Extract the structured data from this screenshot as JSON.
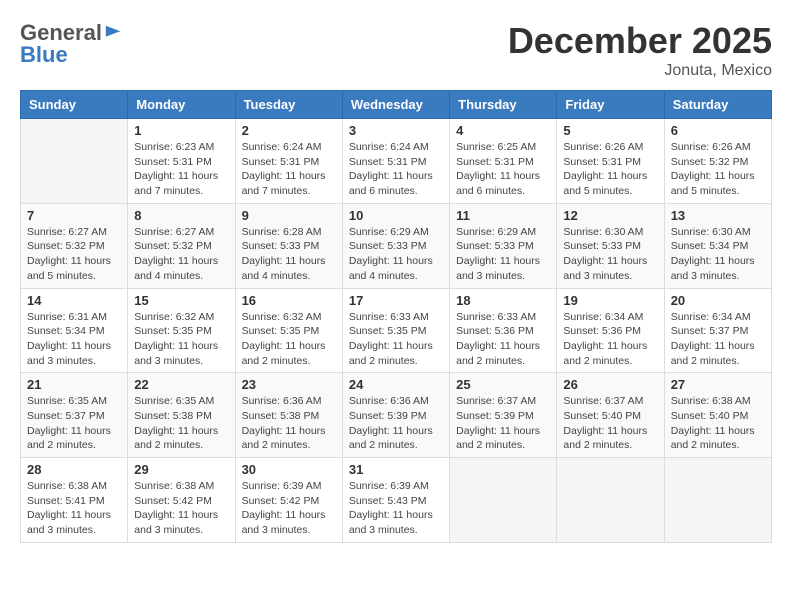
{
  "logo": {
    "general": "General",
    "blue": "Blue"
  },
  "title": {
    "month": "December 2025",
    "location": "Jonuta, Mexico"
  },
  "weekdays": [
    "Sunday",
    "Monday",
    "Tuesday",
    "Wednesday",
    "Thursday",
    "Friday",
    "Saturday"
  ],
  "weeks": [
    [
      {
        "day": "",
        "info": ""
      },
      {
        "day": "1",
        "info": "Sunrise: 6:23 AM\nSunset: 5:31 PM\nDaylight: 11 hours\nand 7 minutes."
      },
      {
        "day": "2",
        "info": "Sunrise: 6:24 AM\nSunset: 5:31 PM\nDaylight: 11 hours\nand 7 minutes."
      },
      {
        "day": "3",
        "info": "Sunrise: 6:24 AM\nSunset: 5:31 PM\nDaylight: 11 hours\nand 6 minutes."
      },
      {
        "day": "4",
        "info": "Sunrise: 6:25 AM\nSunset: 5:31 PM\nDaylight: 11 hours\nand 6 minutes."
      },
      {
        "day": "5",
        "info": "Sunrise: 6:26 AM\nSunset: 5:31 PM\nDaylight: 11 hours\nand 5 minutes."
      },
      {
        "day": "6",
        "info": "Sunrise: 6:26 AM\nSunset: 5:32 PM\nDaylight: 11 hours\nand 5 minutes."
      }
    ],
    [
      {
        "day": "7",
        "info": "Sunrise: 6:27 AM\nSunset: 5:32 PM\nDaylight: 11 hours\nand 5 minutes."
      },
      {
        "day": "8",
        "info": "Sunrise: 6:27 AM\nSunset: 5:32 PM\nDaylight: 11 hours\nand 4 minutes."
      },
      {
        "day": "9",
        "info": "Sunrise: 6:28 AM\nSunset: 5:33 PM\nDaylight: 11 hours\nand 4 minutes."
      },
      {
        "day": "10",
        "info": "Sunrise: 6:29 AM\nSunset: 5:33 PM\nDaylight: 11 hours\nand 4 minutes."
      },
      {
        "day": "11",
        "info": "Sunrise: 6:29 AM\nSunset: 5:33 PM\nDaylight: 11 hours\nand 3 minutes."
      },
      {
        "day": "12",
        "info": "Sunrise: 6:30 AM\nSunset: 5:33 PM\nDaylight: 11 hours\nand 3 minutes."
      },
      {
        "day": "13",
        "info": "Sunrise: 6:30 AM\nSunset: 5:34 PM\nDaylight: 11 hours\nand 3 minutes."
      }
    ],
    [
      {
        "day": "14",
        "info": "Sunrise: 6:31 AM\nSunset: 5:34 PM\nDaylight: 11 hours\nand 3 minutes."
      },
      {
        "day": "15",
        "info": "Sunrise: 6:32 AM\nSunset: 5:35 PM\nDaylight: 11 hours\nand 3 minutes."
      },
      {
        "day": "16",
        "info": "Sunrise: 6:32 AM\nSunset: 5:35 PM\nDaylight: 11 hours\nand 2 minutes."
      },
      {
        "day": "17",
        "info": "Sunrise: 6:33 AM\nSunset: 5:35 PM\nDaylight: 11 hours\nand 2 minutes."
      },
      {
        "day": "18",
        "info": "Sunrise: 6:33 AM\nSunset: 5:36 PM\nDaylight: 11 hours\nand 2 minutes."
      },
      {
        "day": "19",
        "info": "Sunrise: 6:34 AM\nSunset: 5:36 PM\nDaylight: 11 hours\nand 2 minutes."
      },
      {
        "day": "20",
        "info": "Sunrise: 6:34 AM\nSunset: 5:37 PM\nDaylight: 11 hours\nand 2 minutes."
      }
    ],
    [
      {
        "day": "21",
        "info": "Sunrise: 6:35 AM\nSunset: 5:37 PM\nDaylight: 11 hours\nand 2 minutes."
      },
      {
        "day": "22",
        "info": "Sunrise: 6:35 AM\nSunset: 5:38 PM\nDaylight: 11 hours\nand 2 minutes."
      },
      {
        "day": "23",
        "info": "Sunrise: 6:36 AM\nSunset: 5:38 PM\nDaylight: 11 hours\nand 2 minutes."
      },
      {
        "day": "24",
        "info": "Sunrise: 6:36 AM\nSunset: 5:39 PM\nDaylight: 11 hours\nand 2 minutes."
      },
      {
        "day": "25",
        "info": "Sunrise: 6:37 AM\nSunset: 5:39 PM\nDaylight: 11 hours\nand 2 minutes."
      },
      {
        "day": "26",
        "info": "Sunrise: 6:37 AM\nSunset: 5:40 PM\nDaylight: 11 hours\nand 2 minutes."
      },
      {
        "day": "27",
        "info": "Sunrise: 6:38 AM\nSunset: 5:40 PM\nDaylight: 11 hours\nand 2 minutes."
      }
    ],
    [
      {
        "day": "28",
        "info": "Sunrise: 6:38 AM\nSunset: 5:41 PM\nDaylight: 11 hours\nand 3 minutes."
      },
      {
        "day": "29",
        "info": "Sunrise: 6:38 AM\nSunset: 5:42 PM\nDaylight: 11 hours\nand 3 minutes."
      },
      {
        "day": "30",
        "info": "Sunrise: 6:39 AM\nSunset: 5:42 PM\nDaylight: 11 hours\nand 3 minutes."
      },
      {
        "day": "31",
        "info": "Sunrise: 6:39 AM\nSunset: 5:43 PM\nDaylight: 11 hours\nand 3 minutes."
      },
      {
        "day": "",
        "info": ""
      },
      {
        "day": "",
        "info": ""
      },
      {
        "day": "",
        "info": ""
      }
    ]
  ]
}
